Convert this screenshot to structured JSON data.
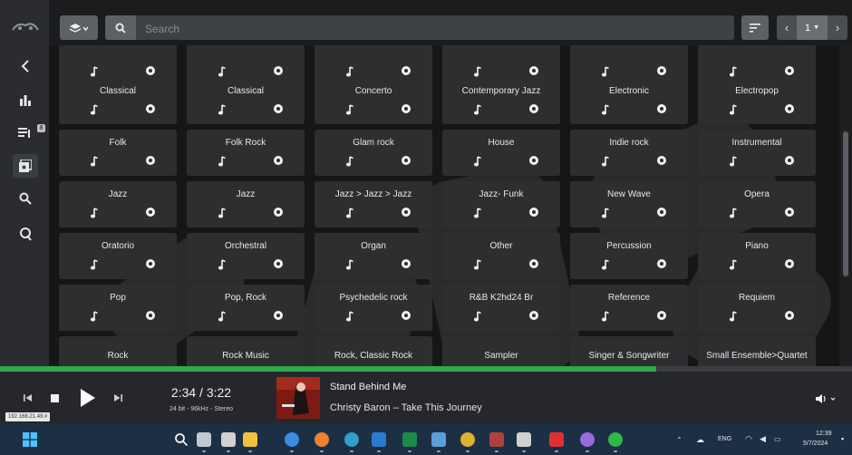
{
  "sidebar": {
    "logo": "logo-icon",
    "items": [
      "back-icon",
      "bar-chart-icon",
      "queue-icon",
      "library-icon",
      "search-icon",
      "q-icon"
    ],
    "queue_badge": "8"
  },
  "topbar": {
    "search_placeholder": "Search",
    "page_current": "1",
    "prev_glyph": "‹",
    "next_glyph": "›"
  },
  "grid": {
    "columns": 6,
    "rows": [
      [
        "",
        "",
        "",
        "",
        "",
        ""
      ],
      [
        "Classical",
        "Classical",
        "Concerto",
        "Contemporary Jazz",
        "Electronic",
        "Electropop"
      ],
      [
        "Folk",
        "Folk Rock",
        "Glam rock",
        "House",
        "Indie rock",
        "Instrumental"
      ],
      [
        "Jazz",
        "Jazz",
        "Jazz > Jazz > Jazz",
        "Jazz- Funk",
        "New Wave",
        "Opera"
      ],
      [
        "Oratorio",
        "Orchestral",
        "Organ",
        "Other",
        "Percussion",
        "Piano"
      ],
      [
        "Pop",
        "Pop, Rock",
        "Psychedelic rock",
        "R&B K2hd24 Br",
        "Reference",
        "Requiem"
      ],
      [
        "Rock",
        "Rock Music",
        "Rock, Classic Rock",
        "Sampler",
        "Singer & Songwriter",
        "Small Ensemble>Quartet"
      ]
    ]
  },
  "player": {
    "progress": 0.77,
    "time": "2:34 / 3:22",
    "format": "24 bit - 96kHz - Stereo",
    "title": "Stand Behind Me",
    "artist_album": "Christy Baron – Take This Journey",
    "ip": "192.168.21.49:#"
  },
  "taskbar": {
    "icons": [
      "start-icon",
      "search-icon",
      "task-view-icon",
      "browser-icon",
      "file-explorer-icon",
      "app-icon",
      "firefox-icon",
      "edge-icon",
      "mail-icon",
      "excel-icon",
      "network-icon",
      "chrome-icon",
      "store-icon",
      "paint-icon",
      "youtube-icon",
      "app-icon",
      "spotify-icon"
    ],
    "lang": "ENG",
    "time": "12:39",
    "date": "5/7/2024"
  },
  "colors": {
    "accent": "#2ea84a",
    "tile": "#2d2e30",
    "taskbar": "#1d2f44"
  }
}
